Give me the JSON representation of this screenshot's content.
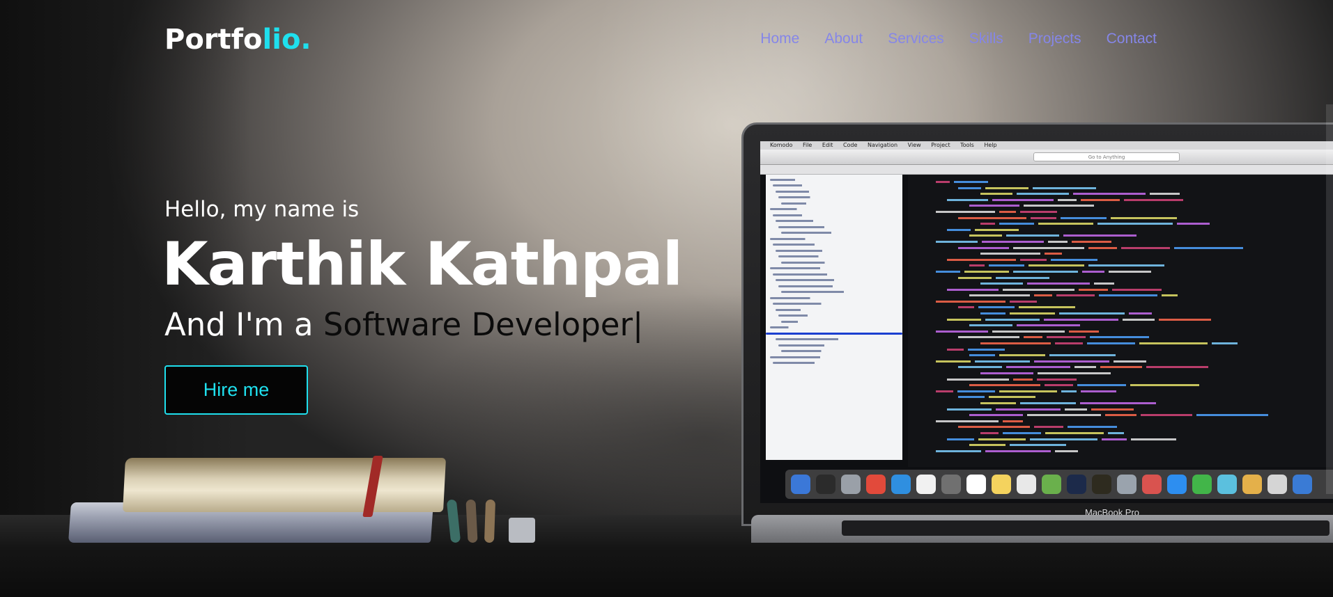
{
  "brand": {
    "logo_main": "Portfo",
    "logo_accent": "lio.",
    "accent_color": "#1fe0ee"
  },
  "nav": {
    "items": [
      {
        "label": "Home"
      },
      {
        "label": "About"
      },
      {
        "label": "Services"
      },
      {
        "label": "Skills"
      },
      {
        "label": "Projects"
      },
      {
        "label": "Contact"
      }
    ],
    "link_color": "#8586e8"
  },
  "hero": {
    "greeting": "Hello, my name is",
    "name": "Karthik Kathpal",
    "role_prefix": "And I'm a ",
    "role_typed": "Software Developer",
    "cursor": "|",
    "cta_label": "Hire me"
  },
  "laptop": {
    "brand_label": "MacBook Pro",
    "menubar_items": [
      "Komodo",
      "File",
      "Edit",
      "Code",
      "Navigation",
      "View",
      "Project",
      "Tools",
      "Help"
    ],
    "search_placeholder": "Go to Anything"
  }
}
